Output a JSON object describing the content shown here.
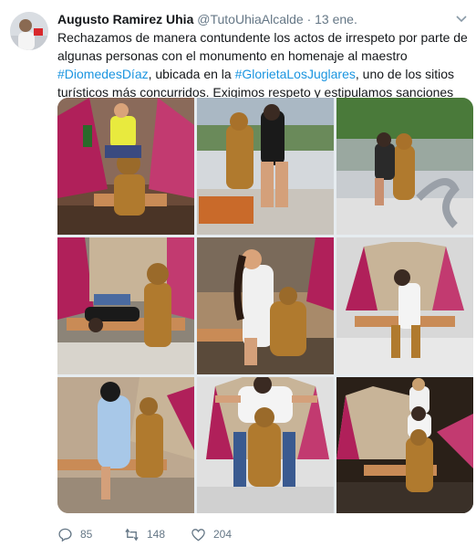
{
  "tweet": {
    "author_name": "Augusto Ramirez Uhia",
    "author_handle": "@TutoUhiaAlcalde",
    "separator": "·",
    "date": "13 ene.",
    "text_parts": {
      "p1": "Rechazamos de manera contundente los actos de irrespeto por parte de algunas personas con el monumento en homenaje al maestro ",
      "tag1": "#DiomedesDíaz",
      "p2": ", ubicada en la ",
      "tag2": "#GlorietaLosJuglares",
      "p3": ", uno de los sitios turísticos más concurridos. Exigimos respeto y estipulamos sanciones ejemplarizantes."
    },
    "replies": "85",
    "retweets": "148",
    "likes": "204"
  },
  "icons": {
    "reply": "reply-icon",
    "retweet": "retweet-icon",
    "like": "heart-icon",
    "more": "chevron-down-icon"
  },
  "colors": {
    "link": "#1b95e0",
    "muted": "#657786",
    "text": "#14171a",
    "statue_bronze": "#b07a2e"
  }
}
